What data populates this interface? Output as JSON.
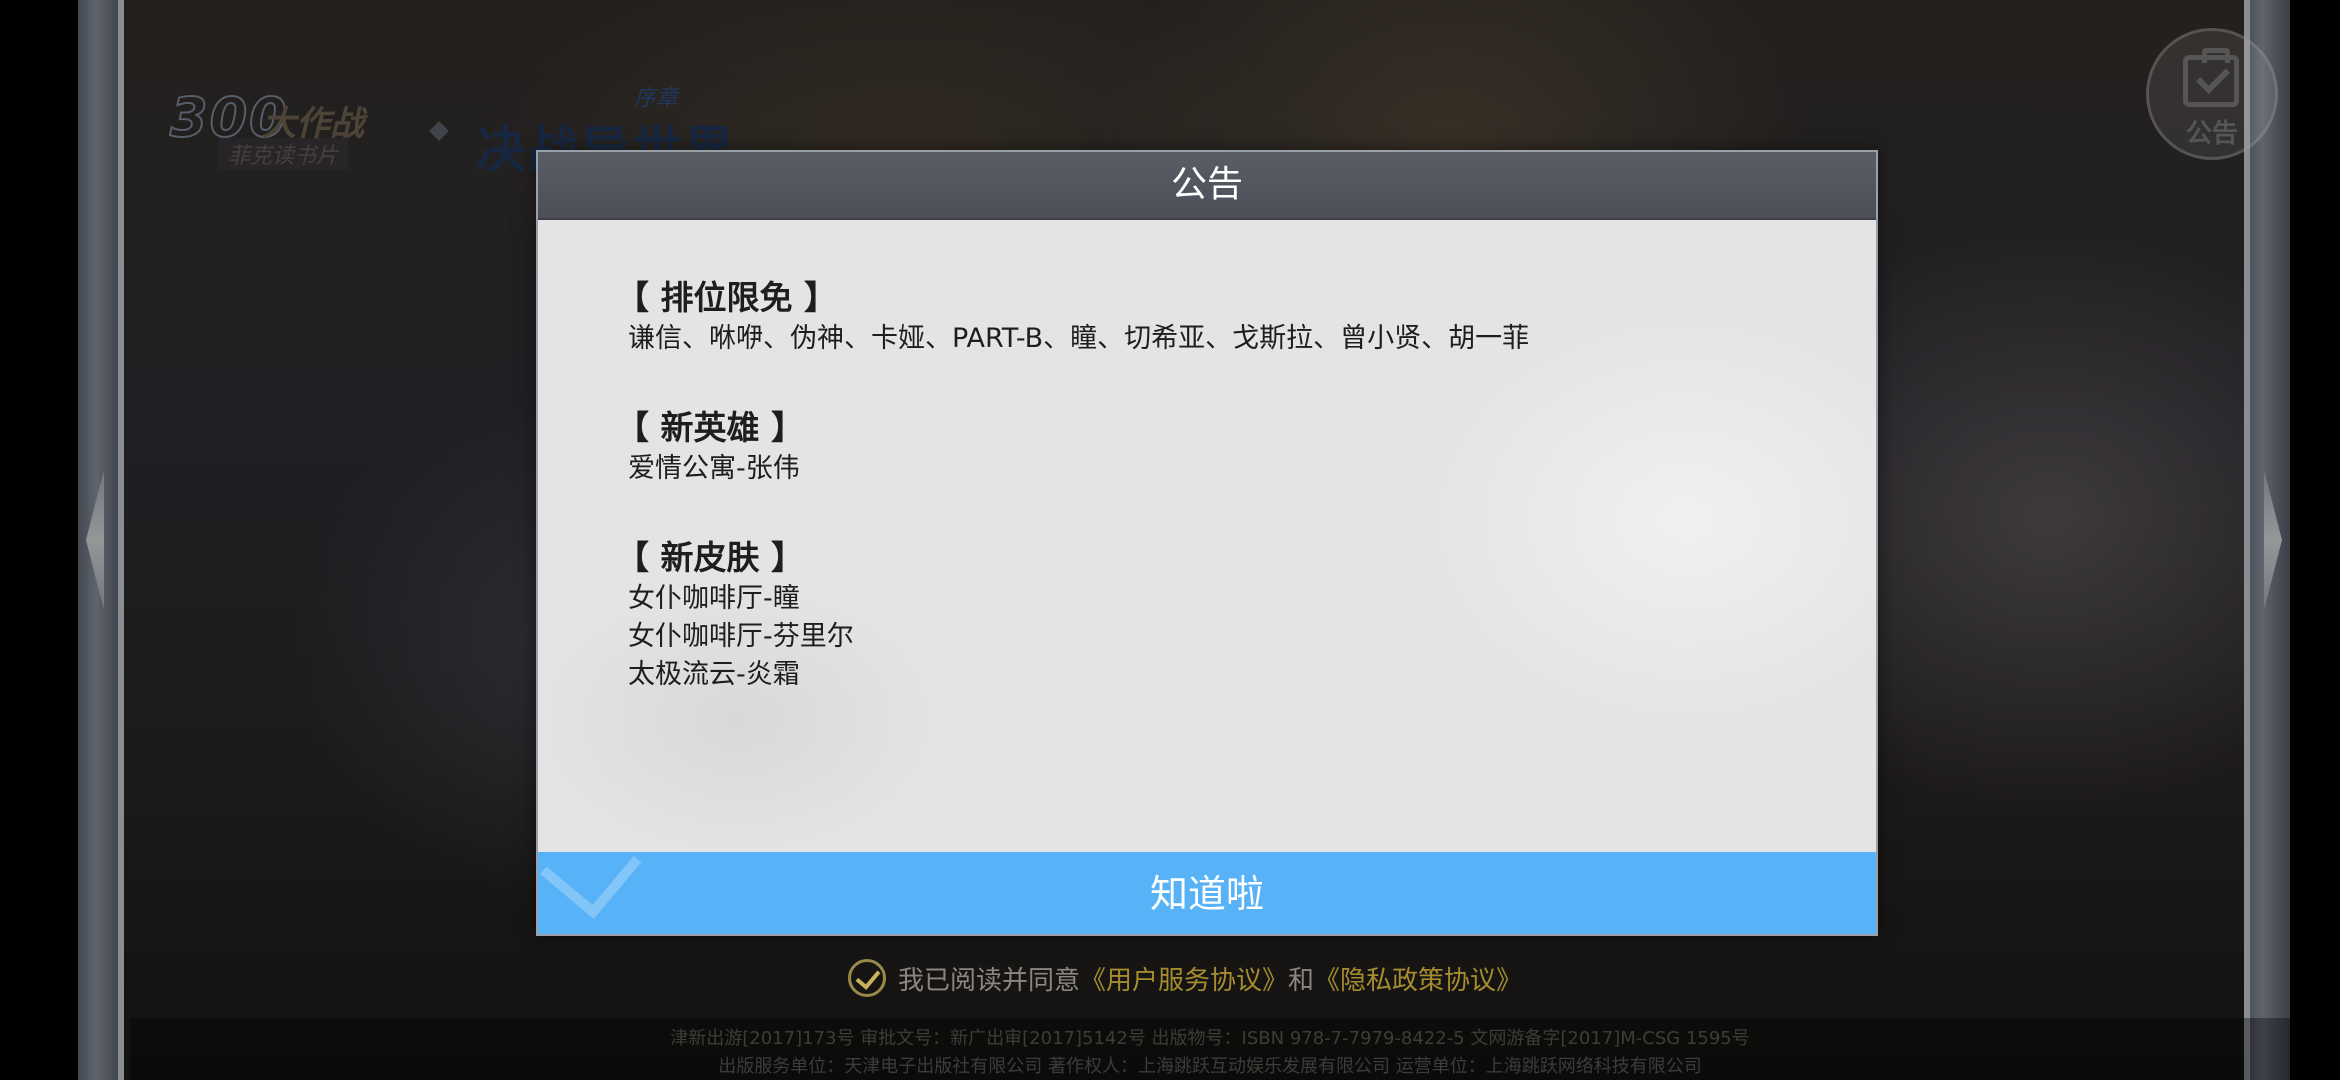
{
  "background": {
    "logo_main_number": "300",
    "logo_main_title": "大作战",
    "logo_main_subtitle": "菲克读书片",
    "logo_partner_prelude": "序章",
    "logo_partner_title": "决战异世界"
  },
  "notice_icon": {
    "label": "公告"
  },
  "modal": {
    "title": "公告",
    "sections": [
      {
        "heading": "【 排位限免 】",
        "lines": [
          "谦信、咻咿、伪神、卡娅、PART-B、瞳、切希亚、戈斯拉、曾小贤、胡一菲"
        ]
      },
      {
        "heading": "【 新英雄 】",
        "lines": [
          "爱情公寓-张伟"
        ]
      },
      {
        "heading": "【 新皮肤 】",
        "lines": [
          "女仆咖啡厅-瞳",
          "女仆咖啡厅-芬里尔",
          "太极流云-炎霜"
        ]
      }
    ],
    "confirm_label": "知道啦"
  },
  "agreement": {
    "prefix": "我已阅读并同意",
    "user_agreement": "《用户服务协议》",
    "conjunction": "和",
    "privacy_policy": "《隐私政策协议》",
    "checked": true
  },
  "footer": {
    "line1": "津新出游[2017]173号  审批文号：新广出审[2017]5142号  出版物号：ISBN 978-7-7979-8422-5  文网游备字[2017]M-CSG 1595号",
    "line2": "出版服务单位：天津电子出版社有限公司  著作权人：上海跳跃互动娱乐发展有限公司  运营单位：上海跳跃网络科技有限公司"
  },
  "colors": {
    "modal_header": "#4c4f58",
    "modal_body": "#e4e4e4",
    "confirm_button": "#58b2f7",
    "agreement_link": "#a58c2e"
  }
}
